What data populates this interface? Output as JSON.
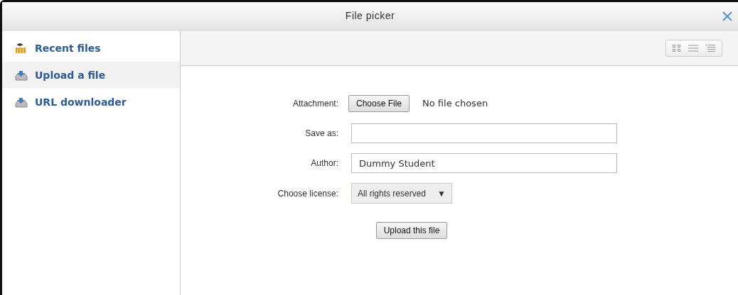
{
  "window": {
    "title": "File picker"
  },
  "sidebar": {
    "items": [
      {
        "label": "Recent files",
        "kind": "moodle",
        "selected": false
      },
      {
        "label": "Upload a file",
        "kind": "upload",
        "selected": true
      },
      {
        "label": "URL downloader",
        "kind": "upload",
        "selected": false
      }
    ]
  },
  "form": {
    "fields": [
      {
        "kind": "file",
        "label": "Attachment:",
        "button": "Choose File",
        "status": "No file chosen"
      },
      {
        "kind": "text",
        "label": "Save as:"
      },
      {
        "kind": "text",
        "label": "Author:",
        "value": "Dummy Student"
      },
      {
        "kind": "select",
        "label": "Choose license:",
        "value": "All rights reserved",
        "caret": "▼"
      }
    ],
    "submit": "Upload this file"
  }
}
